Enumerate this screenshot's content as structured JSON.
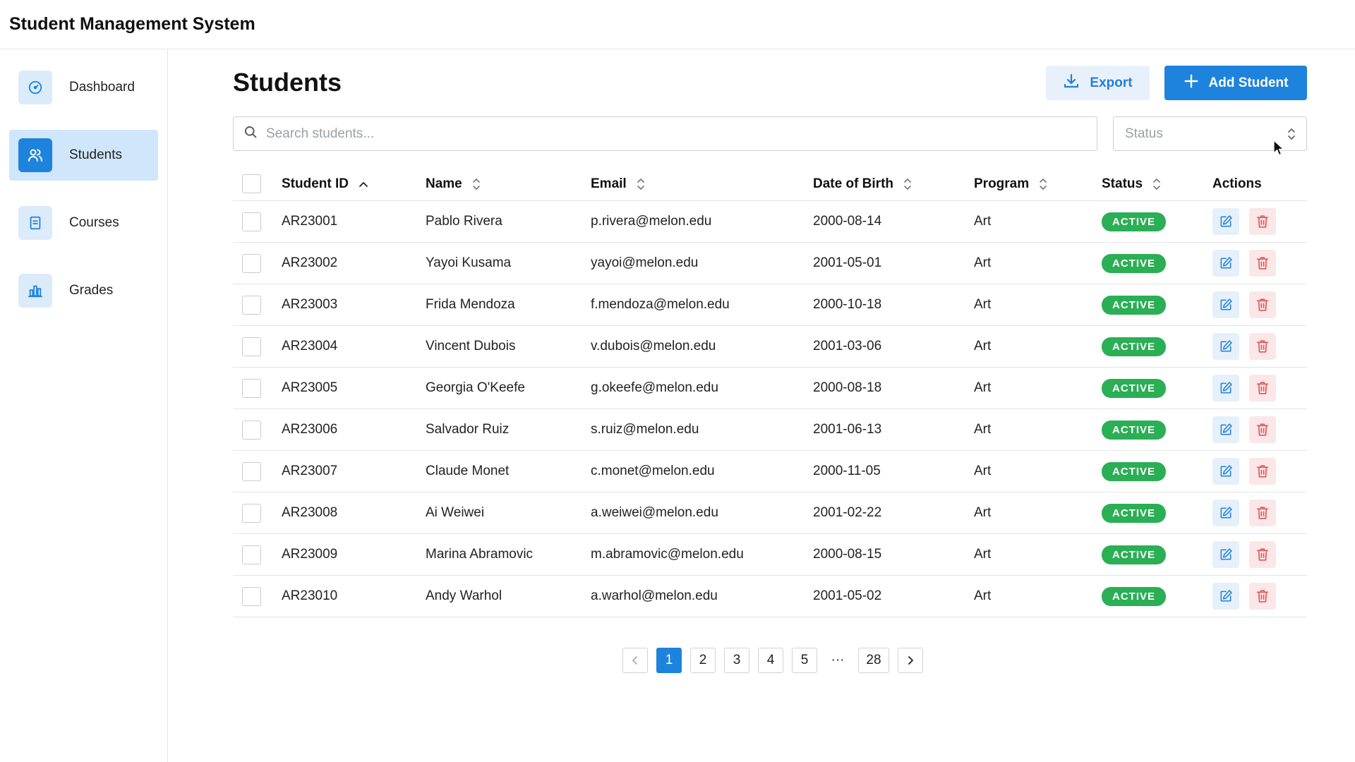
{
  "app": {
    "title": "Student Management System"
  },
  "sidebar": {
    "items": [
      {
        "label": "Dashboard",
        "icon": "gauge-icon",
        "active": false
      },
      {
        "label": "Students",
        "icon": "users-icon",
        "active": true
      },
      {
        "label": "Courses",
        "icon": "book-icon",
        "active": false
      },
      {
        "label": "Grades",
        "icon": "bar-chart-icon",
        "active": false
      }
    ]
  },
  "page": {
    "title": "Students"
  },
  "toolbar": {
    "export_label": "Export",
    "add_label": "Add Student"
  },
  "search": {
    "placeholder": "Search students...",
    "value": ""
  },
  "filter": {
    "status_placeholder": "Status"
  },
  "table": {
    "columns": [
      "Student ID",
      "Name",
      "Email",
      "Date of Birth",
      "Program",
      "Status",
      "Actions"
    ],
    "sorted_column": "Student ID",
    "sort_direction": "ascending",
    "rows": [
      {
        "id": "AR23001",
        "name": "Pablo Rivera",
        "email": "p.rivera@melon.edu",
        "dob": "2000-08-14",
        "program": "Art",
        "status": "ACTIVE"
      },
      {
        "id": "AR23002",
        "name": "Yayoi Kusama",
        "email": "yayoi@melon.edu",
        "dob": "2001-05-01",
        "program": "Art",
        "status": "ACTIVE"
      },
      {
        "id": "AR23003",
        "name": "Frida Mendoza",
        "email": "f.mendoza@melon.edu",
        "dob": "2000-10-18",
        "program": "Art",
        "status": "ACTIVE"
      },
      {
        "id": "AR23004",
        "name": "Vincent Dubois",
        "email": "v.dubois@melon.edu",
        "dob": "2001-03-06",
        "program": "Art",
        "status": "ACTIVE"
      },
      {
        "id": "AR23005",
        "name": "Georgia O'Keefe",
        "email": "g.okeefe@melon.edu",
        "dob": "2000-08-18",
        "program": "Art",
        "status": "ACTIVE"
      },
      {
        "id": "AR23006",
        "name": "Salvador Ruiz",
        "email": "s.ruiz@melon.edu",
        "dob": "2001-06-13",
        "program": "Art",
        "status": "ACTIVE"
      },
      {
        "id": "AR23007",
        "name": "Claude Monet",
        "email": "c.monet@melon.edu",
        "dob": "2000-11-05",
        "program": "Art",
        "status": "ACTIVE"
      },
      {
        "id": "AR23008",
        "name": "Ai Weiwei",
        "email": "a.weiwei@melon.edu",
        "dob": "2001-02-22",
        "program": "Art",
        "status": "ACTIVE"
      },
      {
        "id": "AR23009",
        "name": "Marina Abramovic",
        "email": "m.abramovic@melon.edu",
        "dob": "2000-08-15",
        "program": "Art",
        "status": "ACTIVE"
      },
      {
        "id": "AR23010",
        "name": "Andy Warhol",
        "email": "a.warhol@melon.edu",
        "dob": "2001-05-02",
        "program": "Art",
        "status": "ACTIVE"
      }
    ]
  },
  "pagination": {
    "pages": [
      "1",
      "2",
      "3",
      "4",
      "5"
    ],
    "ellipsis": "···",
    "last": "28",
    "current": "1"
  },
  "colors": {
    "accent": "#1e83dd",
    "active_badge": "#2aaf55",
    "delete": "#e05555"
  }
}
